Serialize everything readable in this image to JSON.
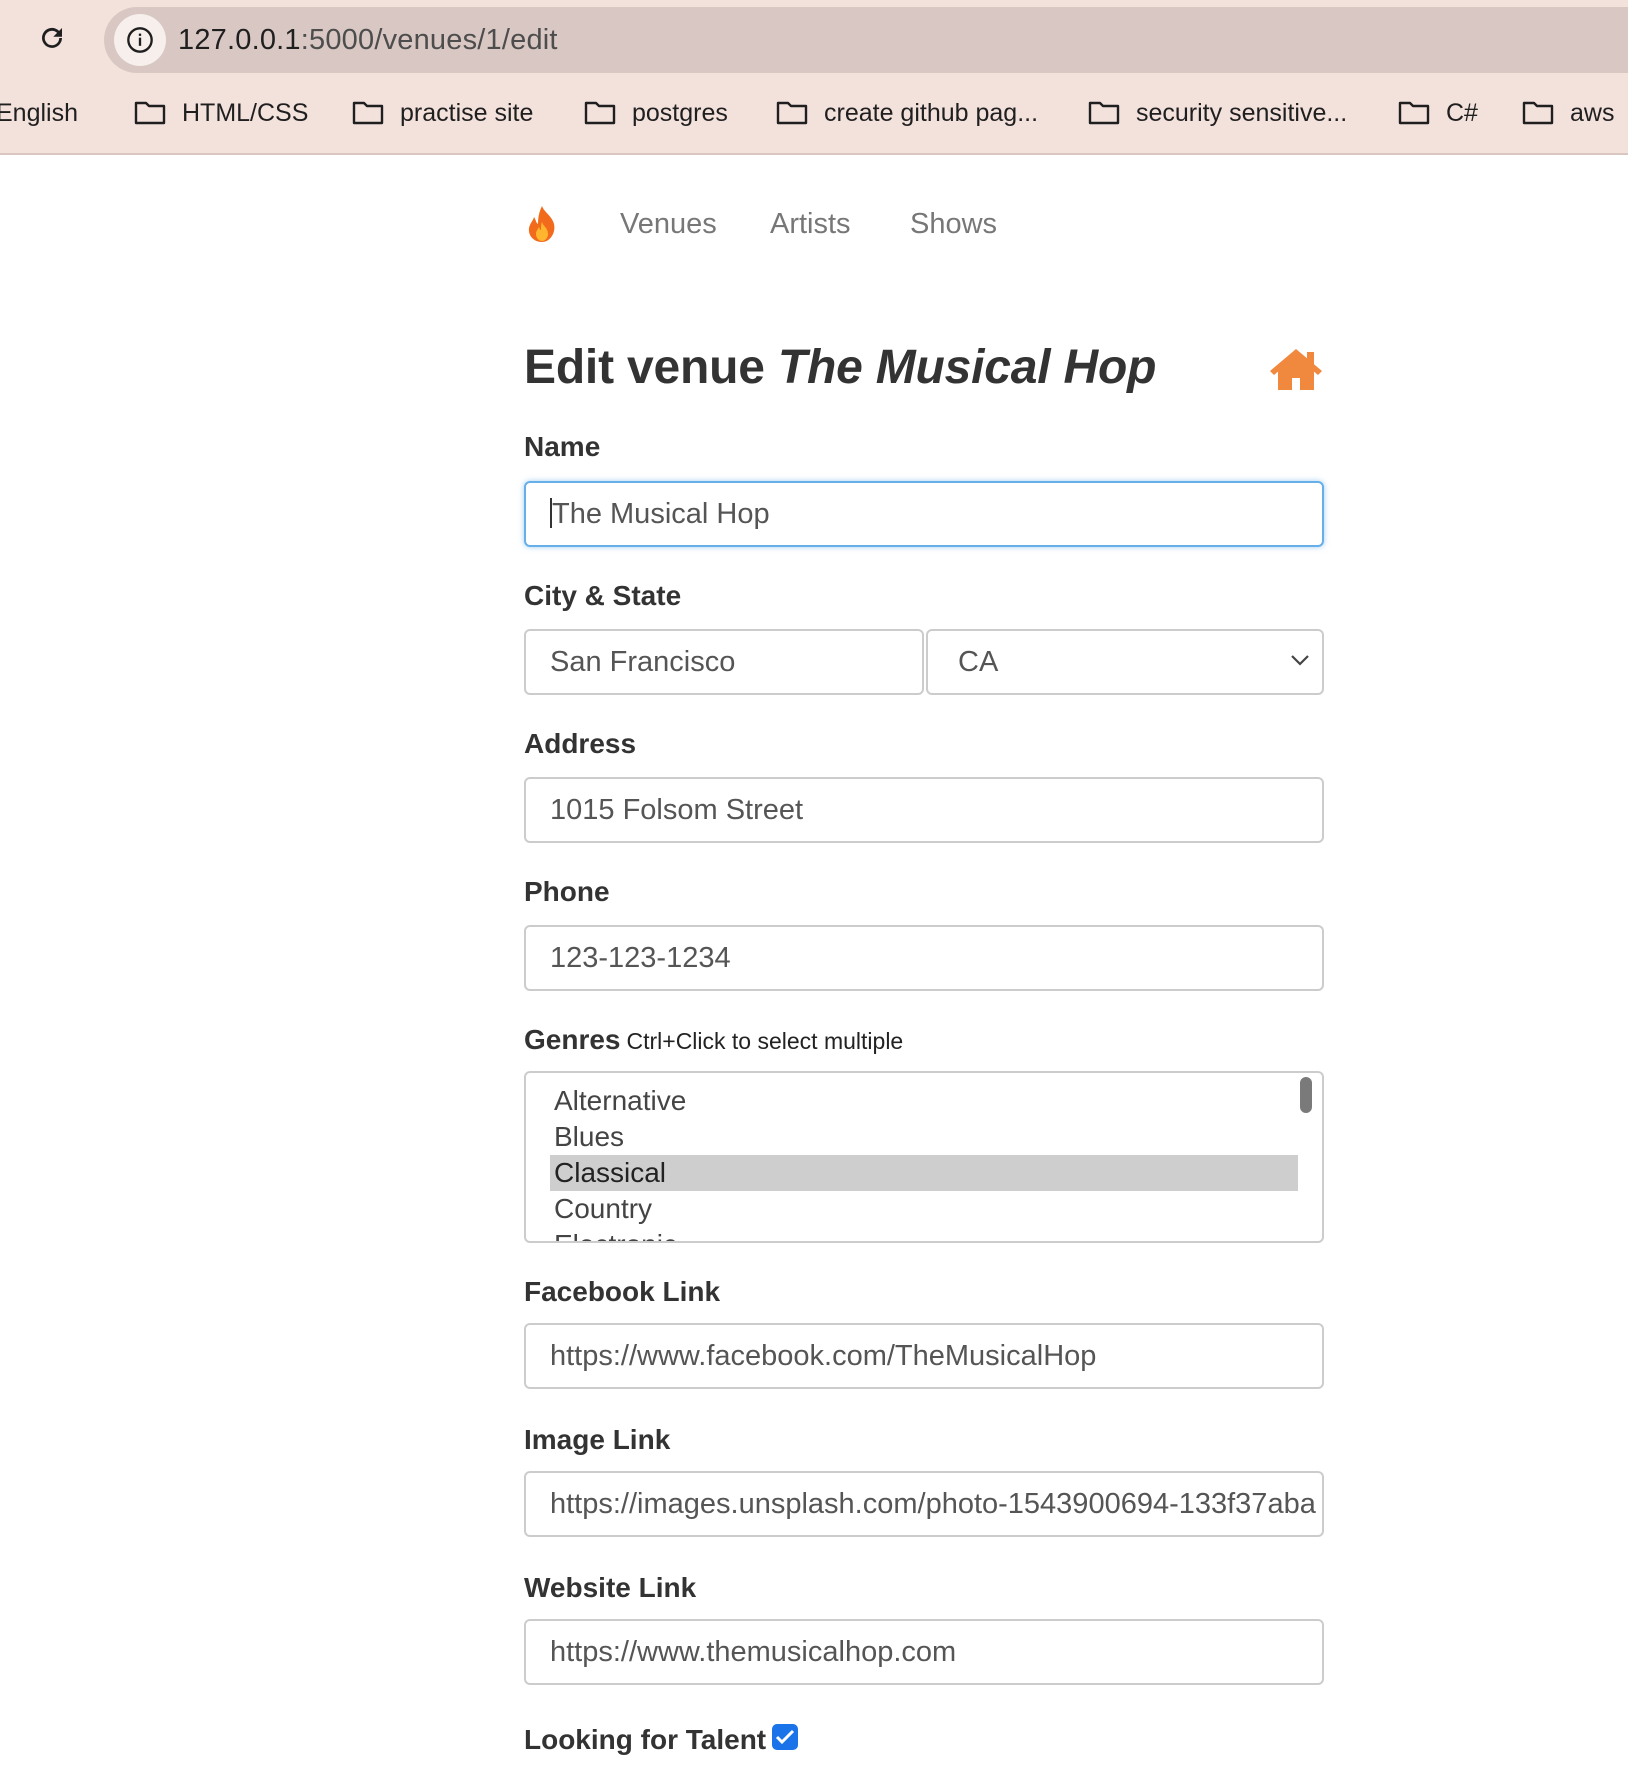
{
  "browser": {
    "url_host": "127.0.0.1",
    "url_path": ":5000/venues/1/edit",
    "bookmarks": [
      {
        "label": "English"
      },
      {
        "label": "HTML/CSS"
      },
      {
        "label": "practise site"
      },
      {
        "label": "postgres"
      },
      {
        "label": "create github pag..."
      },
      {
        "label": "security sensitive..."
      },
      {
        "label": "C#"
      },
      {
        "label": "aws"
      }
    ]
  },
  "nav": {
    "brand_icon": "flame-icon",
    "links": [
      "Venues",
      "Artists",
      "Shows"
    ]
  },
  "form": {
    "title_prefix": "Edit venue",
    "title_name": "The Musical Hop",
    "home_icon": "home-icon",
    "accent_color": "#f0883e",
    "name_label": "Name",
    "name_value": "The Musical Hop",
    "city_state_label": "City & State",
    "city_value": "San Francisco",
    "state_value": "CA",
    "address_label": "Address",
    "address_value": "1015 Folsom Street",
    "phone_label": "Phone",
    "phone_value": "123-123-1234",
    "genres_label": "Genres",
    "genres_hint": "Ctrl+Click to select multiple",
    "genres_options": [
      "Alternative",
      "Blues",
      "Classical",
      "Country",
      "Electronic"
    ],
    "genres_selected": "Classical",
    "facebook_label": "Facebook Link",
    "facebook_value": "https://www.facebook.com/TheMusicalHop",
    "image_label": "Image Link",
    "image_value": "https://images.unsplash.com/photo-1543900694-133f37aba",
    "website_label": "Website Link",
    "website_value": "https://www.themusicalhop.com",
    "seeking_label": "Looking for Talent",
    "seeking_checked": true
  }
}
